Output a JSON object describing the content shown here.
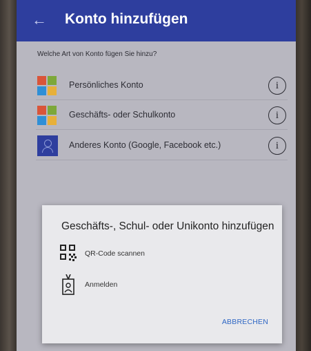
{
  "header": {
    "back_icon": "arrow-left-icon",
    "title": "Konto hinzufügen"
  },
  "question": "Welche Art von Konto fügen Sie hinzu?",
  "accounts": [
    {
      "label": "Persönliches Konto",
      "icon": "microsoft-logo-icon"
    },
    {
      "label": "Geschäfts- oder Schulkonto",
      "icon": "microsoft-logo-icon"
    },
    {
      "label": "Anderes Konto (Google, Facebook etc.)",
      "icon": "person-icon"
    }
  ],
  "info_glyph": "i",
  "dialog": {
    "title": "Geschäfts-, Schul- oder Unikonto hinzufügen",
    "options": [
      {
        "label": "QR-Code scannen",
        "icon": "qr-code-icon"
      },
      {
        "label": "Anmelden",
        "icon": "badge-icon"
      }
    ],
    "cancel_label": "ABBRECHEN"
  },
  "colors": {
    "appbar": "#2e3e9e",
    "accent": "#2e66c4",
    "scrim": "#b8b7c0",
    "dialog": "#e9e9ec"
  }
}
